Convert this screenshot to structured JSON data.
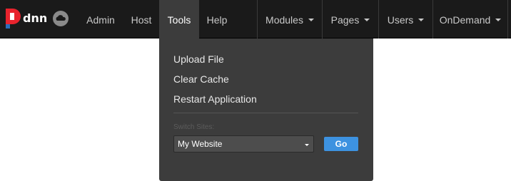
{
  "brand": {
    "logo_text": "dnn",
    "logo_icon": "dnn-logo-icon",
    "cloud_icon": "cloud-icon"
  },
  "nav": {
    "left": [
      {
        "label": "Admin"
      },
      {
        "label": "Host"
      },
      {
        "label": "Tools",
        "active": true
      },
      {
        "label": "Help"
      }
    ],
    "right": [
      {
        "label": "Modules",
        "icon": "caret-down-icon"
      },
      {
        "label": "Pages",
        "icon": "caret-down-icon"
      },
      {
        "label": "Users",
        "icon": "caret-down-icon"
      },
      {
        "label": "OnDemand",
        "icon": "caret-down-icon"
      }
    ]
  },
  "tools_menu": {
    "items": [
      {
        "label": "Upload File"
      },
      {
        "label": "Clear Cache"
      },
      {
        "label": "Restart Application"
      }
    ],
    "switch_sites": {
      "label": "Switch Sites:",
      "selected": "My Website",
      "go_label": "Go"
    }
  },
  "colors": {
    "topbar_bg": "#1a1a1a",
    "dropdown_bg": "#3c3c3c",
    "go_button": "#3d92e0",
    "logo_red": "#e8232d",
    "logo_blue": "#2a6ebb"
  }
}
